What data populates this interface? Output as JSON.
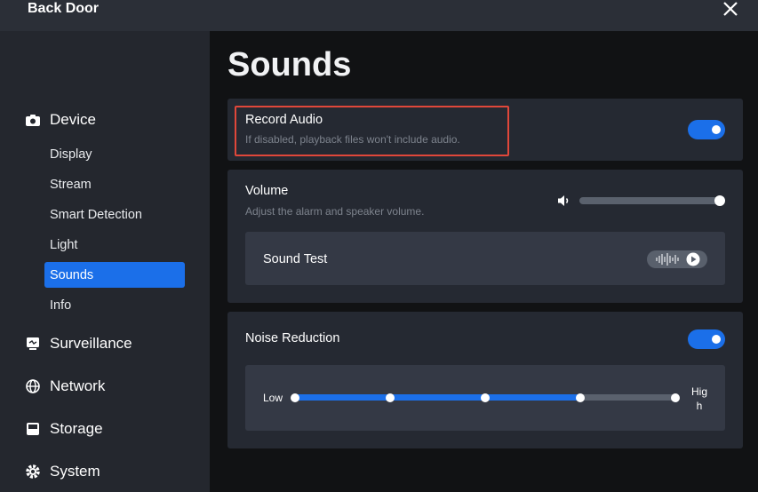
{
  "window": {
    "title": "Back Door",
    "close_icon": "close-icon"
  },
  "sidebar": {
    "groups": [
      {
        "label": "Device",
        "icon": "camera-icon",
        "items": [
          {
            "label": "Display"
          },
          {
            "label": "Stream"
          },
          {
            "label": "Smart Detection"
          },
          {
            "label": "Light"
          },
          {
            "label": "Sounds",
            "active": true
          },
          {
            "label": "Info"
          }
        ]
      },
      {
        "label": "Surveillance",
        "icon": "monitor-icon"
      },
      {
        "label": "Network",
        "icon": "globe-icon"
      },
      {
        "label": "Storage",
        "icon": "storage-icon"
      },
      {
        "label": "System",
        "icon": "gear-icon"
      }
    ]
  },
  "main": {
    "title": "Sounds",
    "record_audio": {
      "label": "Record Audio",
      "description": "If disabled, playback files won't include audio.",
      "enabled": true
    },
    "volume": {
      "label": "Volume",
      "description": "Adjust the alarm and speaker volume.",
      "value_percent": 100,
      "sound_test_label": "Sound Test"
    },
    "noise_reduction": {
      "label": "Noise Reduction",
      "enabled": true,
      "low_label": "Low",
      "high_label": "High",
      "steps": 5,
      "selected_step": 4
    }
  },
  "colors": {
    "accent": "#1b6fe9",
    "sidebar_bg": "#24272e",
    "card_bg": "#252932",
    "highlight": "#e0473a"
  }
}
